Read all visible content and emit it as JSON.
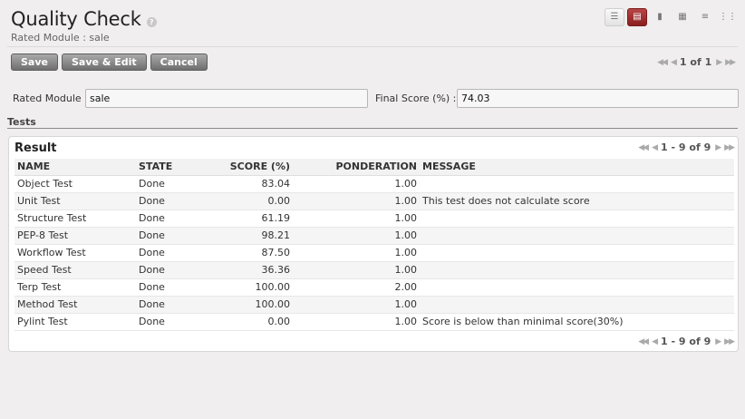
{
  "header": {
    "title": "Quality Check",
    "help_glyph": "?",
    "subtitle": "Rated Module : sale"
  },
  "view_switcher": [
    {
      "name": "list-view-button",
      "icon": "list-icon",
      "glyph": "☰",
      "active": false
    },
    {
      "name": "form-view-button",
      "icon": "form-icon",
      "glyph": "▤",
      "active": true
    },
    {
      "name": "graph-view-button",
      "icon": "bar-chart-icon",
      "glyph": "▮",
      "active": false
    },
    {
      "name": "calendar-view-button",
      "icon": "calendar-icon",
      "glyph": "▦",
      "active": false
    },
    {
      "name": "gantt-view-button",
      "icon": "gantt-icon",
      "glyph": "≡",
      "active": false
    },
    {
      "name": "kanban-view-button",
      "icon": "kanban-icon",
      "glyph": "⋮⋮",
      "active": false
    }
  ],
  "toolbar": {
    "save_label": "Save",
    "save_edit_label": "Save & Edit",
    "cancel_label": "Cancel"
  },
  "record_pager": {
    "text": "1 of 1",
    "first_glyph": "◀◀",
    "prev_glyph": "◀",
    "next_glyph": "▶",
    "last_glyph": "▶▶"
  },
  "form": {
    "rated_module_label": "Rated Module :",
    "rated_module_value": "sale",
    "final_score_label": "Final Score (%) :",
    "final_score_value": "74.03"
  },
  "tests": {
    "section_label": "Tests",
    "grid_title": "Result",
    "pager_text": "1 - 9 of 9",
    "columns": [
      "NAME",
      "STATE",
      "SCORE (%)",
      "PONDERATION",
      "MESSAGE"
    ],
    "rows": [
      {
        "name": "Object Test",
        "state": "Done",
        "score": "83.04",
        "ponderation": "1.00",
        "message": ""
      },
      {
        "name": "Unit Test",
        "state": "Done",
        "score": "0.00",
        "ponderation": "1.00",
        "message": "This test does not calculate score"
      },
      {
        "name": "Structure Test",
        "state": "Done",
        "score": "61.19",
        "ponderation": "1.00",
        "message": ""
      },
      {
        "name": "PEP-8 Test",
        "state": "Done",
        "score": "98.21",
        "ponderation": "1.00",
        "message": ""
      },
      {
        "name": "Workflow Test",
        "state": "Done",
        "score": "87.50",
        "ponderation": "1.00",
        "message": ""
      },
      {
        "name": "Speed Test",
        "state": "Done",
        "score": "36.36",
        "ponderation": "1.00",
        "message": ""
      },
      {
        "name": "Terp Test",
        "state": "Done",
        "score": "100.00",
        "ponderation": "2.00",
        "message": ""
      },
      {
        "name": "Method Test",
        "state": "Done",
        "score": "100.00",
        "ponderation": "1.00",
        "message": ""
      },
      {
        "name": "Pylint Test",
        "state": "Done",
        "score": "0.00",
        "ponderation": "1.00",
        "message": "Score is below than minimal score(30%)"
      }
    ]
  },
  "colors": {
    "active_view": "#8a1f1f",
    "button_gray": "#6f6f6f",
    "background": "#f0eeee"
  }
}
